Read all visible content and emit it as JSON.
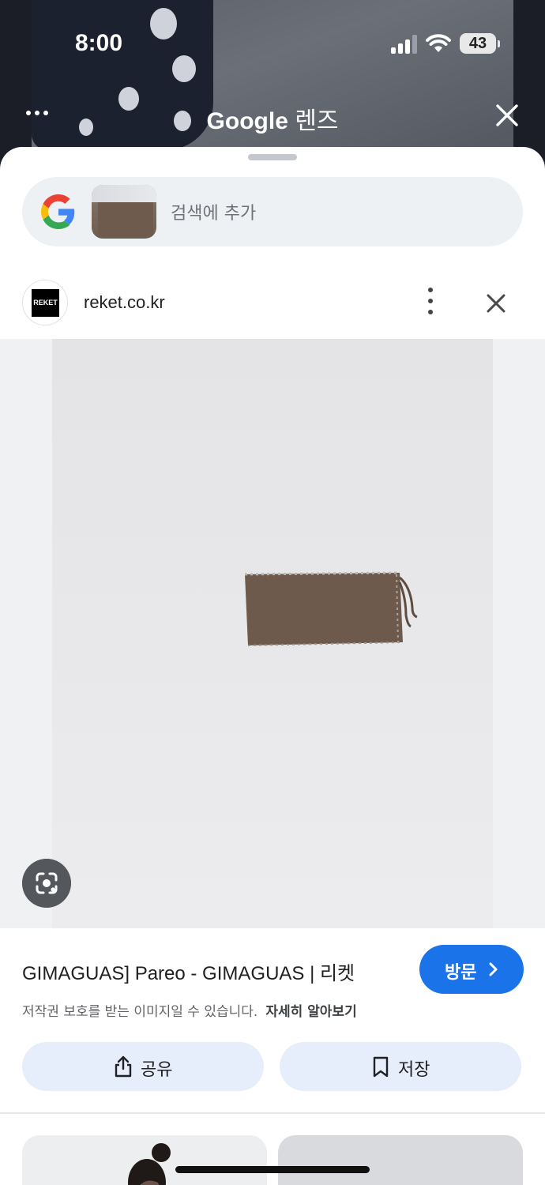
{
  "status_bar": {
    "time": "8:00",
    "battery": "43"
  },
  "lens_header": {
    "title_brand": "Google",
    "title_suffix": "렌즈"
  },
  "search": {
    "placeholder": "검색에 추가"
  },
  "source": {
    "logo_text": "REKET",
    "domain": "reket.co.kr"
  },
  "result": {
    "title": "GIMAGUAS] Pareo - GIMAGUAS | 리켓",
    "visit_label": "방문",
    "copyright_notice": "저작권 보호를 받는 이미지일 수 있습니다.",
    "learn_more": "자세히 알아보기",
    "share_label": "공유",
    "save_label": "저장"
  },
  "colors": {
    "accent": "#1a73e8",
    "action_bg": "#e6eefb",
    "product_brown": "#6e5a4c"
  },
  "icons": [
    "more-horiz-icon",
    "close-icon",
    "google-g-icon",
    "more-vert-icon",
    "lens-camera-icon",
    "chevron-right-icon",
    "share-icon",
    "bookmark-icon"
  ]
}
